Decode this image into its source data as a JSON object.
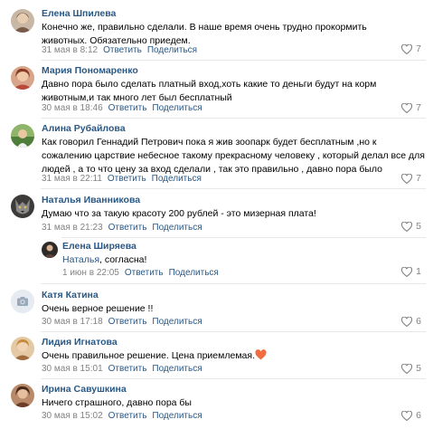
{
  "comments": [
    {
      "author": "Елена Шпилева",
      "text": "Конечно же, правильно сделали. В наше время очень трудно прокормить животных. Обязательно приедем.",
      "date": "31 мая в 8:12",
      "reply_label": "Ответить",
      "share_label": "Поделиться",
      "likes": "7",
      "avatar_icon": "photo-avatar"
    },
    {
      "author": "Мария Пономаренко",
      "text": "Давно пора было сделать платный вход,хоть какие то деньги будут на корм животным,и так много лет был бесплатный",
      "date": "30 мая в 18:46",
      "reply_label": "Ответить",
      "share_label": "Поделиться",
      "likes": "7",
      "avatar_icon": "photo-avatar"
    },
    {
      "author": "Алина Рубайлова",
      "text": "Как говорил Геннадий Петрович пока я жив зоопарк будет бесплатным ,но к сожалению царствие небесное такому прекрасному человеку , который делал все для людей , а то что цену за вход сделали , так это правильно , давно пора было",
      "date": "31 мая в 22:11",
      "reply_label": "Ответить",
      "share_label": "Поделиться",
      "likes": "7",
      "avatar_icon": "photo-avatar"
    },
    {
      "author": "Наталья Иванникова",
      "text": "Думаю что за такую красоту 200 рублей - это мизерная плата!",
      "date": "31 мая в 21:23",
      "reply_label": "Ответить",
      "share_label": "Поделиться",
      "likes": "5",
      "avatar_icon": "photo-avatar"
    },
    {
      "author": "Елена Ширяева",
      "mention": "Наталья",
      "text": ", согласна!",
      "date": "1 июн в 22:05",
      "reply_label": "Ответить",
      "share_label": "Поделиться",
      "likes": "1",
      "avatar_icon": "photo-avatar"
    },
    {
      "author": "Катя Катина",
      "text": "Очень верное решение !!",
      "date": "30 мая в 17:18",
      "reply_label": "Ответить",
      "share_label": "Поделиться",
      "likes": "6",
      "avatar_icon": "camera-placeholder-icon"
    },
    {
      "author": "Лидия Игнатова",
      "text": "Очень правильное решение. Цена приемлемая.",
      "date": "30 мая в 15:01",
      "reply_label": "Ответить",
      "share_label": "Поделиться",
      "likes": "5",
      "avatar_icon": "photo-avatar",
      "emoji": "heart-emoji-icon"
    },
    {
      "author": "Ирина Савушкина",
      "text": "Ничего страшного, давно пора бы",
      "date": "30 мая в 15:02",
      "reply_label": "Ответить",
      "share_label": "Поделиться",
      "likes": "6",
      "avatar_icon": "photo-avatar"
    }
  ],
  "colors": {
    "link": "#2a5885",
    "meta": "#828282",
    "divider": "#e7e8ec",
    "heart_emoji": "#f36c3f"
  }
}
